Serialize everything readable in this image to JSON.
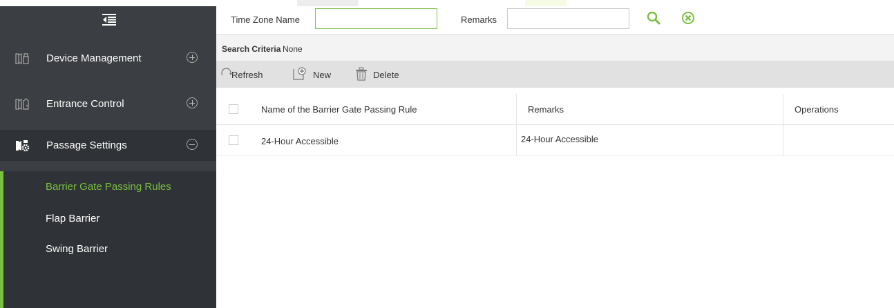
{
  "sidebar": {
    "menu": [
      {
        "label": "Device Management",
        "icon": "device-management-icon",
        "expanded": false
      },
      {
        "label": "Entrance Control",
        "icon": "entrance-control-icon",
        "expanded": false
      },
      {
        "label": "Passage Settings",
        "icon": "passage-settings-icon",
        "expanded": true
      }
    ],
    "submenu": [
      {
        "label": "Barrier Gate Passing Rules",
        "current": true
      },
      {
        "label": "Flap Barrier",
        "current": false
      },
      {
        "label": "Swing Barrier",
        "current": false
      }
    ]
  },
  "search": {
    "time_zone_label": "Time Zone Name",
    "time_zone_value": "",
    "remarks_label": "Remarks",
    "remarks_value": "",
    "search_icon": "search-icon",
    "clear_icon": "clear-icon"
  },
  "criteria": {
    "label": "Search Criteria",
    "value": "None"
  },
  "toolbar": {
    "refresh": "Refresh",
    "new": "New",
    "delete": "Delete"
  },
  "table": {
    "columns": [
      "Name of the Barrier Gate Passing Rule",
      "Remarks",
      "Operations"
    ],
    "rows": [
      {
        "name": "24-Hour Accessible",
        "remarks": "24-Hour Accessible",
        "operations": ""
      }
    ]
  },
  "colors": {
    "sidebar_bg": "#3b3e42",
    "accent_green": "#7ac142",
    "toolbar_bg": "#e1e1e1"
  }
}
